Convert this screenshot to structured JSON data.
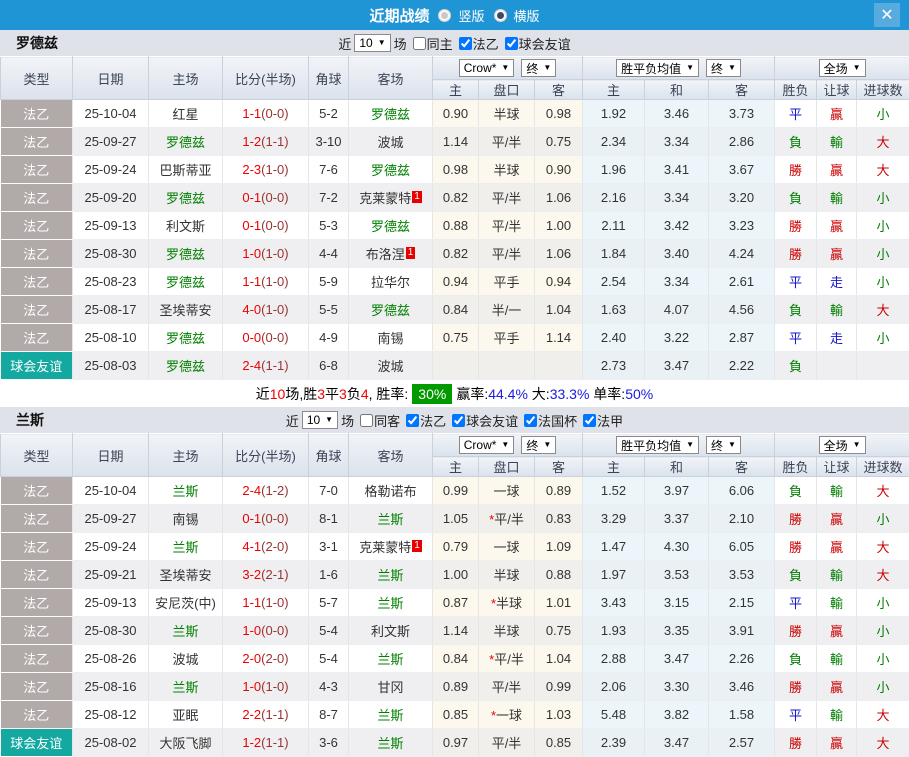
{
  "titlebar": {
    "title": "近期战绩",
    "radios": [
      {
        "label": "竖版",
        "checked": false
      },
      {
        "label": "横版",
        "checked": true
      }
    ],
    "close_icon": "✕"
  },
  "colors": {
    "titlebar_bg": "#2095d6",
    "league_type_bg": "#b2a9a9",
    "friendly_type_bg": "#13a8a0",
    "win_red": "#cc0000",
    "lose_green": "#007e00",
    "draw_blue": "#1414cc",
    "score_red": "#ef0000",
    "half_score_maroon": "#993333",
    "self_team_green": "#008000",
    "rate_badge_bg": "#019a01"
  },
  "table_columns": [
    "类型",
    "日期",
    "主场",
    "比分(半场)",
    "角球",
    "客场",
    "主",
    "盘口",
    "客",
    "主",
    "和",
    "客",
    "胜负",
    "让球",
    "进球数"
  ],
  "odds_dropdowns": {
    "bookmaker": "Crow*",
    "bookmaker_state": "终",
    "avg": "胜平负均值",
    "avg_state": "终",
    "scope": "全场"
  },
  "sections": [
    {
      "team": "罗德兹",
      "filter": {
        "near_label": "近",
        "games_value": "10",
        "games_label": "场",
        "checkboxes": [
          {
            "label": "同主",
            "checked": false
          },
          {
            "label": "法乙",
            "checked": true
          },
          {
            "label": "球会友谊",
            "checked": true
          }
        ]
      },
      "rows": [
        {
          "type": "法乙",
          "friendly": false,
          "date": "25-10-04",
          "home": "红星",
          "home_self": false,
          "score": "1-1",
          "half": "(0-0)",
          "corners": "5-2",
          "away": "罗德兹",
          "away_self": true,
          "away_badge": "",
          "o_home": "0.90",
          "handicap": "半球",
          "star": false,
          "o_away": "0.98",
          "a_home": "1.92",
          "a_draw": "3.46",
          "a_away": "3.73",
          "res": "平",
          "res_c": "blue",
          "han": "贏",
          "han_c": "red",
          "goal": "小",
          "goal_c": "green"
        },
        {
          "type": "法乙",
          "friendly": false,
          "date": "25-09-27",
          "home": "罗德兹",
          "home_self": true,
          "score": "1-2",
          "half": "(1-1)",
          "corners": "3-10",
          "away": "波城",
          "away_self": false,
          "away_badge": "",
          "o_home": "1.14",
          "handicap": "平/半",
          "star": false,
          "o_away": "0.75",
          "a_home": "2.34",
          "a_draw": "3.34",
          "a_away": "2.86",
          "res": "負",
          "res_c": "green",
          "han": "輸",
          "han_c": "green",
          "goal": "大",
          "goal_c": "red"
        },
        {
          "type": "法乙",
          "friendly": false,
          "date": "25-09-24",
          "home": "巴斯蒂亚",
          "home_self": false,
          "score": "2-3",
          "half": "(1-0)",
          "corners": "7-6",
          "away": "罗德兹",
          "away_self": true,
          "away_badge": "",
          "o_home": "0.98",
          "handicap": "半球",
          "star": false,
          "o_away": "0.90",
          "a_home": "1.96",
          "a_draw": "3.41",
          "a_away": "3.67",
          "res": "勝",
          "res_c": "red",
          "han": "贏",
          "han_c": "red",
          "goal": "大",
          "goal_c": "red"
        },
        {
          "type": "法乙",
          "friendly": false,
          "date": "25-09-20",
          "home": "罗德兹",
          "home_self": true,
          "score": "0-1",
          "half": "(0-0)",
          "corners": "7-2",
          "away": "克莱蒙特",
          "away_self": false,
          "away_badge": "1",
          "o_home": "0.82",
          "handicap": "平/半",
          "star": false,
          "o_away": "1.06",
          "a_home": "2.16",
          "a_draw": "3.34",
          "a_away": "3.20",
          "res": "負",
          "res_c": "green",
          "han": "輸",
          "han_c": "green",
          "goal": "小",
          "goal_c": "green"
        },
        {
          "type": "法乙",
          "friendly": false,
          "date": "25-09-13",
          "home": "利文斯",
          "home_self": false,
          "score": "0-1",
          "half": "(0-0)",
          "corners": "5-3",
          "away": "罗德兹",
          "away_self": true,
          "away_badge": "",
          "o_home": "0.88",
          "handicap": "平/半",
          "star": false,
          "o_away": "1.00",
          "a_home": "2.11",
          "a_draw": "3.42",
          "a_away": "3.23",
          "res": "勝",
          "res_c": "red",
          "han": "贏",
          "han_c": "red",
          "goal": "小",
          "goal_c": "green"
        },
        {
          "type": "法乙",
          "friendly": false,
          "date": "25-08-30",
          "home": "罗德兹",
          "home_self": true,
          "score": "1-0",
          "half": "(1-0)",
          "corners": "4-4",
          "away": "布洛涅",
          "away_self": false,
          "away_badge": "1",
          "o_home": "0.82",
          "handicap": "平/半",
          "star": false,
          "o_away": "1.06",
          "a_home": "1.84",
          "a_draw": "3.40",
          "a_away": "4.24",
          "res": "勝",
          "res_c": "red",
          "han": "贏",
          "han_c": "red",
          "goal": "小",
          "goal_c": "green"
        },
        {
          "type": "法乙",
          "friendly": false,
          "date": "25-08-23",
          "home": "罗德兹",
          "home_self": true,
          "score": "1-1",
          "half": "(1-0)",
          "corners": "5-9",
          "away": "拉华尔",
          "away_self": false,
          "away_badge": "",
          "o_home": "0.94",
          "handicap": "平手",
          "star": false,
          "o_away": "0.94",
          "a_home": "2.54",
          "a_draw": "3.34",
          "a_away": "2.61",
          "res": "平",
          "res_c": "blue",
          "han": "走",
          "han_c": "blue",
          "goal": "小",
          "goal_c": "green"
        },
        {
          "type": "法乙",
          "friendly": false,
          "date": "25-08-17",
          "home": "圣埃蒂安",
          "home_self": false,
          "score": "4-0",
          "half": "(1-0)",
          "corners": "5-5",
          "away": "罗德兹",
          "away_self": true,
          "away_badge": "",
          "o_home": "0.84",
          "handicap": "半/一",
          "star": false,
          "o_away": "1.04",
          "a_home": "1.63",
          "a_draw": "4.07",
          "a_away": "4.56",
          "res": "負",
          "res_c": "green",
          "han": "輸",
          "han_c": "green",
          "goal": "大",
          "goal_c": "red"
        },
        {
          "type": "法乙",
          "friendly": false,
          "date": "25-08-10",
          "home": "罗德兹",
          "home_self": true,
          "score": "0-0",
          "half": "(0-0)",
          "corners": "4-9",
          "away": "南锡",
          "away_self": false,
          "away_badge": "",
          "o_home": "0.75",
          "handicap": "平手",
          "star": false,
          "o_away": "1.14",
          "a_home": "2.40",
          "a_draw": "3.22",
          "a_away": "2.87",
          "res": "平",
          "res_c": "blue",
          "han": "走",
          "han_c": "blue",
          "goal": "小",
          "goal_c": "green"
        },
        {
          "type": "球会友谊",
          "friendly": true,
          "date": "25-08-03",
          "home": "罗德兹",
          "home_self": true,
          "score": "2-4",
          "half": "(1-1)",
          "corners": "6-8",
          "away": "波城",
          "away_self": false,
          "away_badge": "",
          "o_home": "",
          "handicap": "",
          "star": false,
          "o_away": "",
          "a_home": "2.73",
          "a_draw": "3.47",
          "a_away": "2.22",
          "res": "負",
          "res_c": "green",
          "han": "",
          "han_c": "blue",
          "goal": "",
          "goal_c": "green"
        }
      ],
      "summary": {
        "segments": [
          {
            "t": "近",
            "c": "k"
          },
          {
            "t": "10",
            "c": "r"
          },
          {
            "t": "场,胜",
            "c": "k"
          },
          {
            "t": "3",
            "c": "r"
          },
          {
            "t": "平",
            "c": "k"
          },
          {
            "t": "3",
            "c": "r"
          },
          {
            "t": "负",
            "c": "k"
          },
          {
            "t": "4",
            "c": "r"
          },
          {
            "t": ", 胜率:",
            "c": "k"
          },
          {
            "t": "30%",
            "c": "g"
          },
          {
            "t": "赢率:",
            "c": "k"
          },
          {
            "t": "44.4%",
            "c": "b"
          },
          {
            "t": " 大:",
            "c": "k"
          },
          {
            "t": "33.3%",
            "c": "b"
          },
          {
            "t": " 单率:",
            "c": "k"
          },
          {
            "t": "50%",
            "c": "b"
          }
        ]
      }
    },
    {
      "team": "兰斯",
      "filter": {
        "near_label": "近",
        "games_value": "10",
        "games_label": "场",
        "checkboxes": [
          {
            "label": "同客",
            "checked": false
          },
          {
            "label": "法乙",
            "checked": true
          },
          {
            "label": "球会友谊",
            "checked": true
          },
          {
            "label": "法国杯",
            "checked": true
          },
          {
            "label": "法甲",
            "checked": true
          }
        ]
      },
      "rows": [
        {
          "type": "法乙",
          "friendly": false,
          "date": "25-10-04",
          "home": "兰斯",
          "home_self": true,
          "score": "2-4",
          "half": "(1-2)",
          "corners": "7-0",
          "away": "格勒诺布",
          "away_self": false,
          "away_badge": "",
          "o_home": "0.99",
          "handicap": "一球",
          "star": false,
          "o_away": "0.89",
          "a_home": "1.52",
          "a_draw": "3.97",
          "a_away": "6.06",
          "res": "負",
          "res_c": "green",
          "han": "輸",
          "han_c": "green",
          "goal": "大",
          "goal_c": "red"
        },
        {
          "type": "法乙",
          "friendly": false,
          "date": "25-09-27",
          "home": "南锡",
          "home_self": false,
          "score": "0-1",
          "half": "(0-0)",
          "corners": "8-1",
          "away": "兰斯",
          "away_self": true,
          "away_badge": "",
          "o_home": "1.05",
          "handicap": "平/半",
          "star": true,
          "o_away": "0.83",
          "a_home": "3.29",
          "a_draw": "3.37",
          "a_away": "2.10",
          "res": "勝",
          "res_c": "red",
          "han": "贏",
          "han_c": "red",
          "goal": "小",
          "goal_c": "green"
        },
        {
          "type": "法乙",
          "friendly": false,
          "date": "25-09-24",
          "home": "兰斯",
          "home_self": true,
          "score": "4-1",
          "half": "(2-0)",
          "corners": "3-1",
          "away": "克莱蒙特",
          "away_self": false,
          "away_badge": "1",
          "o_home": "0.79",
          "handicap": "一球",
          "star": false,
          "o_away": "1.09",
          "a_home": "1.47",
          "a_draw": "4.30",
          "a_away": "6.05",
          "res": "勝",
          "res_c": "red",
          "han": "贏",
          "han_c": "red",
          "goal": "大",
          "goal_c": "red"
        },
        {
          "type": "法乙",
          "friendly": false,
          "date": "25-09-21",
          "home": "圣埃蒂安",
          "home_self": false,
          "score": "3-2",
          "half": "(2-1)",
          "corners": "1-6",
          "away": "兰斯",
          "away_self": true,
          "away_badge": "",
          "o_home": "1.00",
          "handicap": "半球",
          "star": false,
          "o_away": "0.88",
          "a_home": "1.97",
          "a_draw": "3.53",
          "a_away": "3.53",
          "res": "負",
          "res_c": "green",
          "han": "輸",
          "han_c": "green",
          "goal": "大",
          "goal_c": "red"
        },
        {
          "type": "法乙",
          "friendly": false,
          "date": "25-09-13",
          "home": "安尼茨(中)",
          "home_self": false,
          "score": "1-1",
          "half": "(1-0)",
          "corners": "5-7",
          "away": "兰斯",
          "away_self": true,
          "away_badge": "",
          "o_home": "0.87",
          "handicap": "半球",
          "star": true,
          "o_away": "1.01",
          "a_home": "3.43",
          "a_draw": "3.15",
          "a_away": "2.15",
          "res": "平",
          "res_c": "blue",
          "han": "輸",
          "han_c": "green",
          "goal": "小",
          "goal_c": "green"
        },
        {
          "type": "法乙",
          "friendly": false,
          "date": "25-08-30",
          "home": "兰斯",
          "home_self": true,
          "score": "1-0",
          "half": "(0-0)",
          "corners": "5-4",
          "away": "利文斯",
          "away_self": false,
          "away_badge": "",
          "o_home": "1.14",
          "handicap": "半球",
          "star": false,
          "o_away": "0.75",
          "a_home": "1.93",
          "a_draw": "3.35",
          "a_away": "3.91",
          "res": "勝",
          "res_c": "red",
          "han": "贏",
          "han_c": "red",
          "goal": "小",
          "goal_c": "green"
        },
        {
          "type": "法乙",
          "friendly": false,
          "date": "25-08-26",
          "home": "波城",
          "home_self": false,
          "score": "2-0",
          "half": "(2-0)",
          "corners": "5-4",
          "away": "兰斯",
          "away_self": true,
          "away_badge": "",
          "o_home": "0.84",
          "handicap": "平/半",
          "star": true,
          "o_away": "1.04",
          "a_home": "2.88",
          "a_draw": "3.47",
          "a_away": "2.26",
          "res": "負",
          "res_c": "green",
          "han": "輸",
          "han_c": "green",
          "goal": "小",
          "goal_c": "green"
        },
        {
          "type": "法乙",
          "friendly": false,
          "date": "25-08-16",
          "home": "兰斯",
          "home_self": true,
          "score": "1-0",
          "half": "(1-0)",
          "corners": "4-3",
          "away": "甘冈",
          "away_self": false,
          "away_badge": "",
          "o_home": "0.89",
          "handicap": "平/半",
          "star": false,
          "o_away": "0.99",
          "a_home": "2.06",
          "a_draw": "3.30",
          "a_away": "3.46",
          "res": "勝",
          "res_c": "red",
          "han": "贏",
          "han_c": "red",
          "goal": "小",
          "goal_c": "green"
        },
        {
          "type": "法乙",
          "friendly": false,
          "date": "25-08-12",
          "home": "亚眠",
          "home_self": false,
          "score": "2-2",
          "half": "(1-1)",
          "corners": "8-7",
          "away": "兰斯",
          "away_self": true,
          "away_badge": "",
          "o_home": "0.85",
          "handicap": "一球",
          "star": true,
          "o_away": "1.03",
          "a_home": "5.48",
          "a_draw": "3.82",
          "a_away": "1.58",
          "res": "平",
          "res_c": "blue",
          "han": "輸",
          "han_c": "green",
          "goal": "大",
          "goal_c": "red"
        },
        {
          "type": "球会友谊",
          "friendly": true,
          "date": "25-08-02",
          "home": "大阪飞脚",
          "home_self": false,
          "score": "1-2",
          "half": "(1-1)",
          "corners": "3-6",
          "away": "兰斯",
          "away_self": true,
          "away_badge": "",
          "o_home": "0.97",
          "handicap": "平/半",
          "star": false,
          "o_away": "0.85",
          "a_home": "2.39",
          "a_draw": "3.47",
          "a_away": "2.57",
          "res": "勝",
          "res_c": "red",
          "han": "贏",
          "han_c": "red",
          "goal": "大",
          "goal_c": "red"
        }
      ]
    }
  ]
}
